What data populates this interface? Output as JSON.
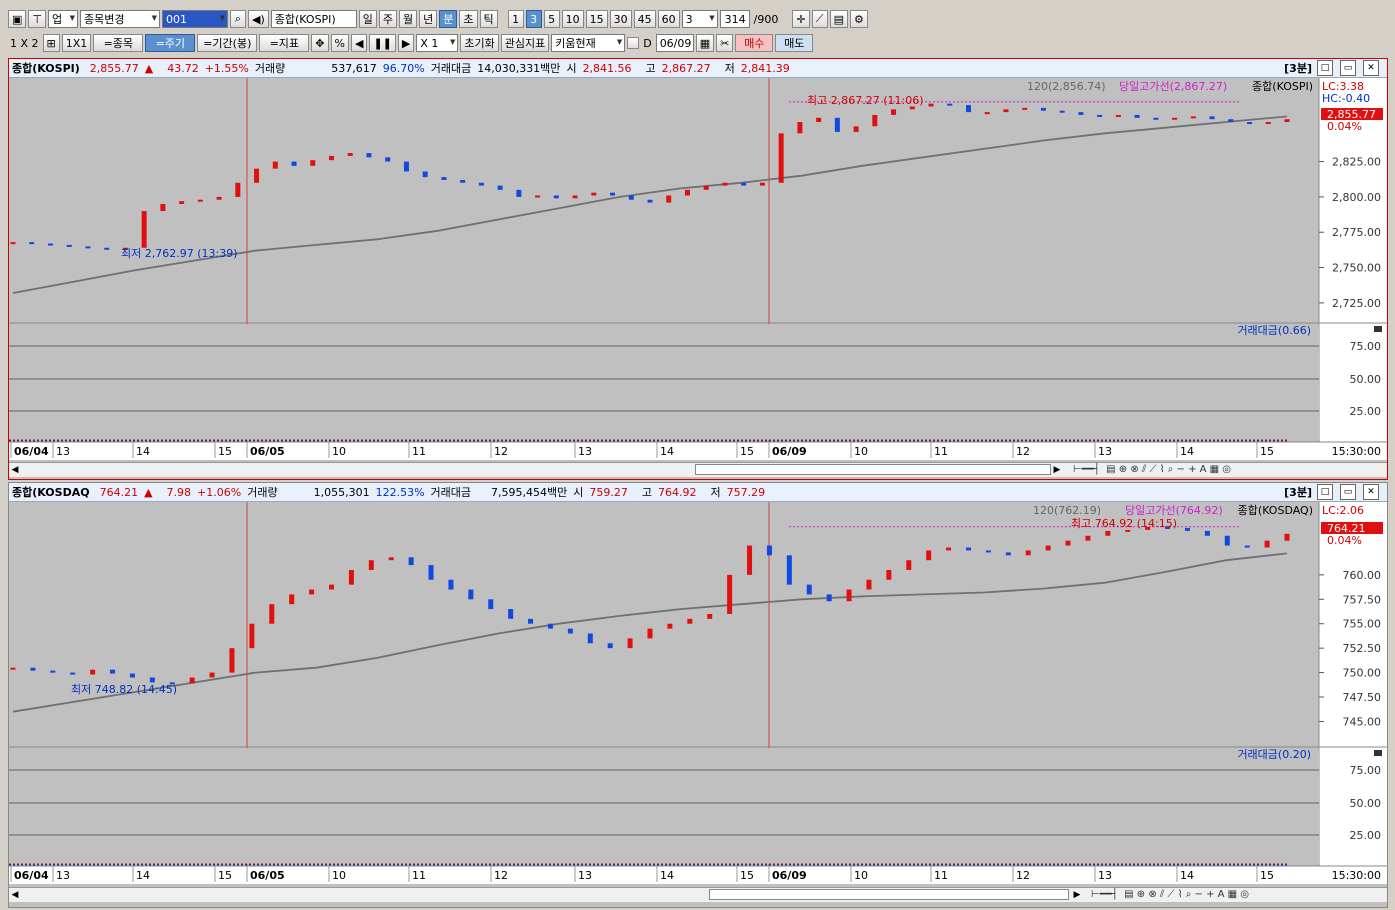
{
  "toolbar1": {
    "category": "업",
    "change_btn": "종목변경",
    "code": "001",
    "name": "종합(KOSPI)",
    "periods": [
      "일",
      "주",
      "월",
      "년",
      "분",
      "초",
      "틱"
    ],
    "active_period": "분",
    "intervals": [
      "1",
      "3",
      "5",
      "10",
      "15",
      "30",
      "45",
      "60"
    ],
    "active_interval": "3",
    "count_select": "3",
    "count": "314",
    "count_total": "/900"
  },
  "toolbar2": {
    "layout1": "1 X 2",
    "layout2": "1X1",
    "btn_stock": "=종목",
    "btn_period": "=주기",
    "btn_range": "=기간(봉)",
    "btn_indicator": "=지표",
    "pct": "%",
    "multiplier": "X 1",
    "reset": "초기화",
    "watch": "관심지표",
    "kiwoom": "키움현재",
    "date_prefix": "D",
    "date": "06/09",
    "buy": "매수",
    "sell": "매도"
  },
  "panels": [
    {
      "id": "kospi",
      "name": "종합(KOSPI)",
      "price": "2,855.77",
      "arrow": "▲",
      "change": "43.72",
      "change_pct": "+1.55%",
      "vol_label": "거래량",
      "volume": "537,617",
      "vol_pct": "96.70%",
      "amt_label": "거래대금",
      "amount": "14,030,331백만",
      "open_label": "시",
      "open": "2,841.56",
      "high_label": "고",
      "high": "2,867.27",
      "low_label": "저",
      "low": "2,841.39",
      "period_tag": "[3분]",
      "legend_ma": "120(2,856.74)",
      "legend_high_line": "당일고가선(2,867.27)",
      "legend_name": "종합(KOSPI)",
      "lc": "LC:3.38",
      "hc": "HC:-0.40",
      "last_price_tag": "2,855.77",
      "last_pct_tag": "0.04%",
      "high_note": "최고 2,867.27 (11:06)",
      "low_note": "최저 2,762.97 (13:39)",
      "sub_legend": "거래대금(0.66)",
      "time_label": "15:30:00",
      "y_ticks": [
        "2,825.00",
        "2,800.00",
        "2,775.00",
        "2,750.00",
        "2,725.00"
      ],
      "sub_ticks": [
        "75.00",
        "50.00",
        "25.00"
      ],
      "x_labels": [
        "06/04",
        "13",
        "14",
        "15",
        "06/05",
        "10",
        "11",
        "12",
        "13",
        "14",
        "15",
        "06/09",
        "10",
        "11",
        "12",
        "13",
        "14",
        "15"
      ]
    },
    {
      "id": "kosdaq",
      "name": "종합(KOSDAQ",
      "price": "764.21",
      "arrow": "▲",
      "change": "7.98",
      "change_pct": "+1.06%",
      "vol_label": "거래량",
      "volume": "1,055,301",
      "vol_pct": "122.53%",
      "amt_label": "거래대금",
      "amount": "7,595,454백만",
      "open_label": "시",
      "open": "759.27",
      "high_label": "고",
      "high": "764.92",
      "low_label": "저",
      "low": "757.29",
      "period_tag": "[3분]",
      "legend_ma": "120(762.19)",
      "legend_high_line": "당일고가선(764.92)",
      "legend_name": "종합(KOSDAQ)",
      "lc": "LC:2.06",
      "hc": "",
      "last_price_tag": "764.21",
      "last_pct_tag": "0.04%",
      "high_note": "최고 764.92 (14:15)",
      "low_note": "최저 748.82 (14:45)",
      "sub_legend": "거래대금(0.20)",
      "time_label": "15:30:00",
      "y_ticks": [
        "760.00",
        "757.50",
        "755.00",
        "752.50",
        "750.00",
        "747.50",
        "745.00"
      ],
      "sub_ticks": [
        "75.00",
        "50.00",
        "25.00"
      ],
      "x_labels": [
        "06/04",
        "13",
        "14",
        "15",
        "06/05",
        "10",
        "11",
        "12",
        "13",
        "14",
        "15",
        "06/09",
        "10",
        "11",
        "12",
        "13",
        "14",
        "15"
      ]
    }
  ],
  "chart_data": [
    {
      "type": "line",
      "title": "종합(KOSPI)",
      "ylim": [
        2715,
        2870
      ],
      "ma_name": "120",
      "candles_close": [
        2768,
        2767,
        2766,
        2765,
        2764,
        2763,
        2764,
        2790,
        2795,
        2797,
        2798,
        2800,
        2810,
        2820,
        2825,
        2822,
        2826,
        2829,
        2831,
        2828,
        2825,
        2818,
        2814,
        2812,
        2810,
        2808,
        2805,
        2800,
        2801,
        2799,
        2801,
        2803,
        2801,
        2798,
        2796,
        2801,
        2805,
        2808,
        2810,
        2808,
        2810,
        2845,
        2853,
        2856,
        2846,
        2850,
        2858,
        2862,
        2864,
        2866,
        2865,
        2860,
        2860,
        2862,
        2863,
        2861,
        2860,
        2858,
        2857,
        2858,
        2856,
        2855,
        2856,
        2857,
        2855,
        2853,
        2852,
        2853,
        2855
      ],
      "ma": [
        2732,
        2740,
        2748,
        2755,
        2762,
        2766,
        2770,
        2776,
        2784,
        2792,
        2800,
        2806,
        2810,
        2815,
        2822,
        2828,
        2834,
        2840,
        2845,
        2849,
        2853,
        2857
      ]
    },
    {
      "type": "line",
      "title": "종합(KOSDAQ)",
      "ylim": [
        743,
        765
      ],
      "ma_name": "120",
      "candles_close": [
        750.5,
        750.2,
        750.0,
        749.8,
        750.3,
        749.9,
        749.5,
        749.0,
        748.9,
        749.5,
        750.0,
        752.5,
        755.0,
        757.0,
        758.0,
        758.5,
        759.0,
        760.5,
        761.5,
        761.8,
        761.0,
        759.5,
        758.5,
        757.5,
        756.5,
        755.5,
        755.0,
        754.5,
        754.0,
        753.0,
        752.5,
        753.5,
        754.5,
        755.0,
        755.5,
        756.0,
        760.0,
        763.0,
        762.0,
        759.0,
        758.0,
        757.3,
        758.5,
        759.5,
        760.5,
        761.5,
        762.5,
        762.8,
        762.5,
        762.3,
        762.0,
        762.5,
        763.0,
        763.5,
        764.0,
        764.5,
        764.6,
        764.9,
        764.8,
        764.5,
        764.0,
        763.0,
        762.8,
        763.5,
        764.2
      ],
      "ma": [
        746.0,
        747.0,
        748.0,
        749.0,
        750.0,
        750.5,
        751.5,
        752.8,
        754.0,
        755.0,
        755.8,
        756.5,
        757.0,
        757.5,
        757.8,
        758.0,
        758.2,
        758.6,
        759.2,
        760.3,
        761.5,
        762.2
      ]
    }
  ],
  "icons": [
    "window-icon",
    "pin-icon",
    "search-icon",
    "speaker-icon",
    "crosshair-icon",
    "calendar-icon",
    "settings-icon",
    "save-icon"
  ]
}
